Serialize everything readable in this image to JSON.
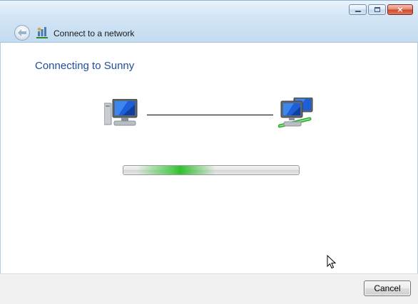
{
  "window": {
    "nav_title": "Connect to a network",
    "caption": {
      "minimize": "minimize",
      "maximize": "maximize",
      "close": "×"
    }
  },
  "main": {
    "heading": "Connecting to Sunny",
    "progress_fraction": 0.3
  },
  "footer": {
    "cancel_label": "Cancel"
  },
  "icons": {
    "back": "back-arrow-icon",
    "network": "network-connection-icon",
    "local_computer": "computer-icon",
    "network_computers": "network-computers-icon",
    "cursor": "mouse-pointer-icon"
  },
  "colors": {
    "heading": "#1f4e9b",
    "glass_top": "#e9f3fb",
    "glass_bottom": "#c3dbf0",
    "progress_glow": "#2cbe2c",
    "footer_bg": "#f0f0f0"
  }
}
